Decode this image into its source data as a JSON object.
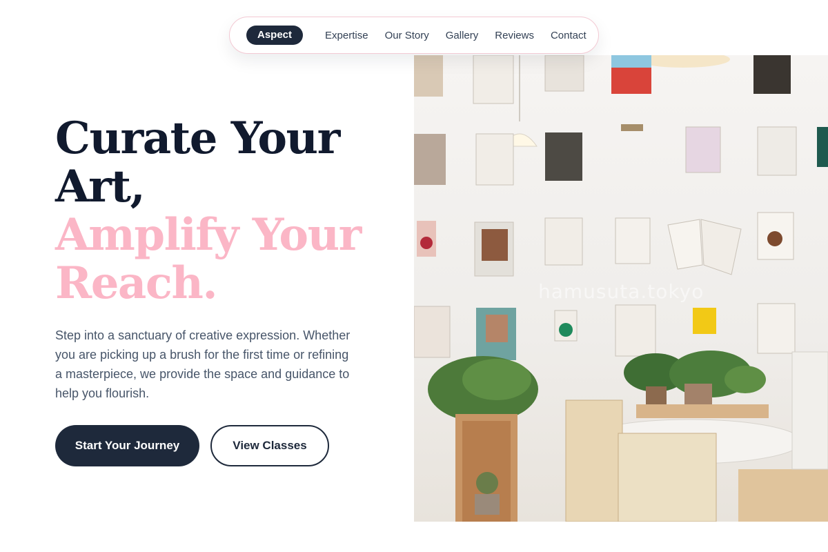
{
  "nav": {
    "brand": "Aspect",
    "links": [
      "Expertise",
      "Our Story",
      "Gallery",
      "Reviews",
      "Contact"
    ]
  },
  "hero": {
    "headline_line1": "Curate Your",
    "headline_line2": "Art,",
    "headline_line3": "Amplify Your",
    "headline_line4": "Reach.",
    "subtitle": "Step into a sanctuary of creative expression. Whether you are picking up a brush for the first time or refining a masterpiece, we provide the space and guidance to help you flourish.",
    "primary_cta": "Start Your Journey",
    "secondary_cta": "View Classes"
  },
  "image": {
    "watermark": "hamusuta.tokyo"
  },
  "colors": {
    "navy": "#1e293b",
    "pink": "#fbb6c6",
    "nav_border": "#f3c9d3"
  }
}
